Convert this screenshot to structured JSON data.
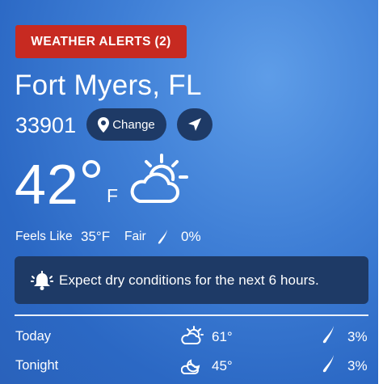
{
  "alerts": {
    "label": "WEATHER ALERTS (2)"
  },
  "location": {
    "city": "Fort Myers, FL",
    "zip": "33901",
    "change_label": "Change"
  },
  "current": {
    "temperature": "42",
    "unit": "F",
    "feels_like_label": "Feels Like",
    "feels_like_value": "35°F",
    "condition": "Fair",
    "precip_chance": "0%",
    "condition_icon": "partly-cloudy-day-icon"
  },
  "banner": {
    "message": "Expect dry conditions for the next 6 hours.",
    "icon": "bell-icon"
  },
  "forecast": [
    {
      "period": "Today",
      "icon": "partly-cloudy-day-icon",
      "temp": "61°",
      "precip": "3%"
    },
    {
      "period": "Tonight",
      "icon": "partly-cloudy-night-icon",
      "temp": "45°",
      "precip": "3%"
    }
  ],
  "colors": {
    "alert": "#c72a21",
    "pill": "#1e3a66",
    "sky": "#3f7fd6"
  }
}
